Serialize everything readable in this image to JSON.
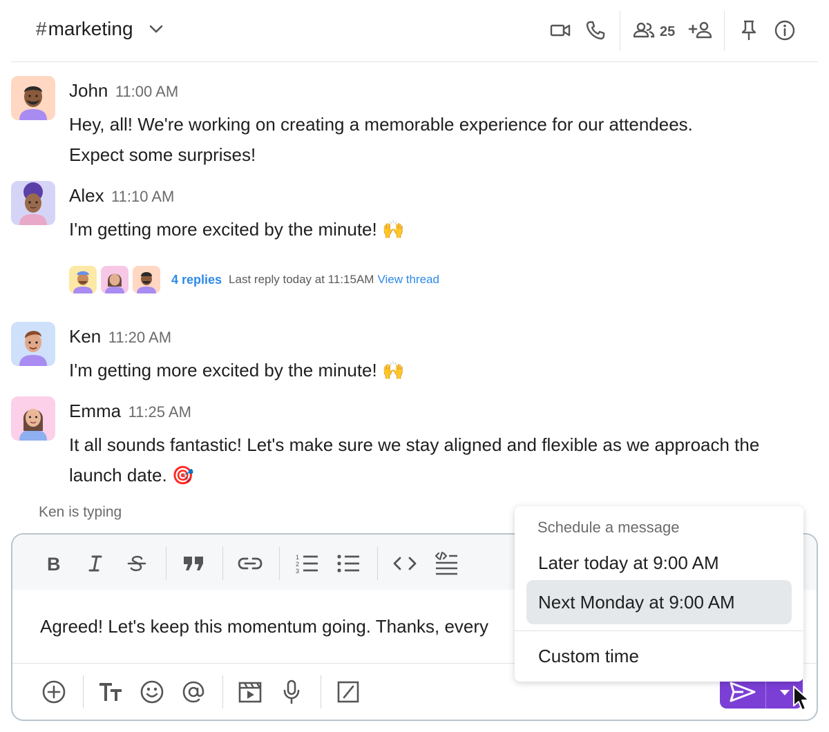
{
  "header": {
    "hash": "#",
    "channel_name": "marketing",
    "member_count": "25",
    "icons": [
      "chevron-down-icon",
      "video-call-icon",
      "phone-icon",
      "members-icon",
      "add-member-icon",
      "pin-icon",
      "info-icon"
    ]
  },
  "messages": [
    {
      "user": "John",
      "time": "11:00 AM",
      "text": "Hey, all! We're working on creating a memorable experience for our attendees. Expect some surprises!"
    },
    {
      "user": "Alex",
      "time": "11:10 AM",
      "text": "I'm getting more excited by the minute! 🙌"
    },
    {
      "user": "Ken",
      "time": "11:20 AM",
      "text": "I'm getting more excited by the minute! 🙌"
    },
    {
      "user": "Emma",
      "time": "11:25 AM",
      "text": "It all sounds fantastic! Let's make sure we stay aligned and flexible as we approach the launch date. 🎯"
    }
  ],
  "thread": {
    "replies": "4 replies",
    "last_reply": "Last reply today at 11:15AM",
    "view_thread": "View thread"
  },
  "typing_indicator": "Ken is typing",
  "composer": {
    "text": "Agreed! Let's keep this momentum going. Thanks, every",
    "toolbar": [
      "bold-icon",
      "italic-icon",
      "strikethrough-icon",
      "quote-icon",
      "link-icon",
      "ordered-list-icon",
      "bullet-list-icon",
      "code-icon",
      "code-block-icon"
    ],
    "bottom": [
      "add-icon",
      "text-format-icon",
      "emoji-icon",
      "mention-icon",
      "video-clip-icon",
      "microphone-icon",
      "slash-command-icon",
      "send-icon",
      "dropdown-arrow-icon"
    ]
  },
  "schedule_menu": {
    "title": "Schedule a message",
    "options": [
      "Later today at 9:00 AM",
      "Next Monday at 9:00 AM",
      "Custom time"
    ],
    "highlighted": "Next Monday at 9:00 AM"
  },
  "colors": {
    "accent": "#7b3fd6",
    "link": "#2e8ae6",
    "highlight": "#e4e8eb",
    "avatar_john": "#ffd7c2",
    "avatar_alex": "#d6d4f6",
    "avatar_ken": "#cfe0fb",
    "avatar_emma": "#fbd0e8"
  }
}
